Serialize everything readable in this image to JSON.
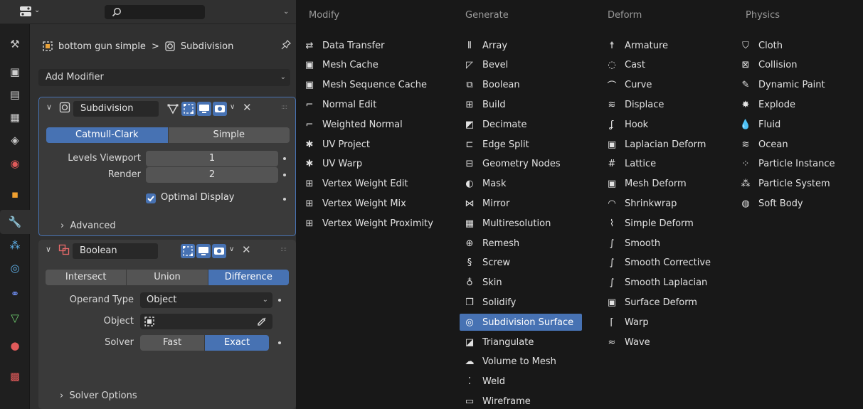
{
  "header": {
    "editor_icon": "properties-editor-icon",
    "search_icon": "search-icon"
  },
  "tabs": [
    {
      "name": "tool-tab",
      "icon": "tool-icon",
      "active": false
    },
    {
      "name": "render-tab",
      "icon": "camera-back-icon",
      "active": false
    },
    {
      "name": "output-tab",
      "icon": "printer-icon",
      "active": false
    },
    {
      "name": "view-layer-tab",
      "icon": "image-icon",
      "active": false
    },
    {
      "name": "scene-tab",
      "icon": "scene-icon",
      "active": false
    },
    {
      "name": "world-tab",
      "icon": "world-icon",
      "active": false
    },
    {
      "name": "object-tab",
      "icon": "object-icon",
      "active": false
    },
    {
      "name": "modifiers-tab",
      "icon": "wrench-icon",
      "active": true
    },
    {
      "name": "particles-tab",
      "icon": "particles-icon",
      "active": false
    },
    {
      "name": "physics-tab",
      "icon": "physics-icon",
      "active": false
    },
    {
      "name": "constraints-tab",
      "icon": "constraints-icon",
      "active": false
    },
    {
      "name": "data-tab",
      "icon": "mesh-data-icon",
      "active": false
    },
    {
      "name": "material-tab",
      "icon": "material-icon",
      "active": false
    },
    {
      "name": "texture-tab",
      "icon": "texture-icon",
      "active": false
    }
  ],
  "breadcrumb": {
    "object": "bottom gun simple",
    "separator": ">",
    "modifier": "Subdivision"
  },
  "add_modifier": {
    "label": "Add Modifier"
  },
  "subdivision": {
    "name": "Subdivision",
    "mode_options": [
      "Catmull-Clark",
      "Simple"
    ],
    "mode_selected": "Catmull-Clark",
    "levels_viewport_label": "Levels Viewport",
    "levels_viewport": "1",
    "render_label": "Render",
    "render": "2",
    "optimal_display_label": "Optimal Display",
    "optimal_display_checked": true,
    "advanced_label": "Advanced"
  },
  "boolean": {
    "name": "Boolean",
    "operation_options": [
      "Intersect",
      "Union",
      "Difference"
    ],
    "operation_selected": "Difference",
    "operand_type_label": "Operand Type",
    "operand_type": "Object",
    "object_label": "Object",
    "object_value": "",
    "solver_label": "Solver",
    "solver_options": [
      "Fast",
      "Exact"
    ],
    "solver_selected": "Exact",
    "solver_options_label": "Solver Options"
  },
  "menu": {
    "columns": [
      {
        "title": "Modify",
        "items": [
          {
            "label": "Data Transfer",
            "icon": "data-transfer-icon"
          },
          {
            "label": "Mesh Cache",
            "icon": "mesh-cache-icon"
          },
          {
            "label": "Mesh Sequence Cache",
            "icon": "mesh-sequence-cache-icon"
          },
          {
            "label": "Normal Edit",
            "icon": "normal-edit-icon"
          },
          {
            "label": "Weighted Normal",
            "icon": "weighted-normal-icon"
          },
          {
            "label": "UV Project",
            "icon": "uv-project-icon"
          },
          {
            "label": "UV Warp",
            "icon": "uv-warp-icon"
          },
          {
            "label": "Vertex Weight Edit",
            "icon": "vertex-weight-icon"
          },
          {
            "label": "Vertex Weight Mix",
            "icon": "vertex-weight-icon"
          },
          {
            "label": "Vertex Weight Proximity",
            "icon": "vertex-weight-icon"
          }
        ]
      },
      {
        "title": "Generate",
        "items": [
          {
            "label": "Array",
            "icon": "array-icon"
          },
          {
            "label": "Bevel",
            "icon": "bevel-icon"
          },
          {
            "label": "Boolean",
            "icon": "boolean-icon"
          },
          {
            "label": "Build",
            "icon": "build-icon"
          },
          {
            "label": "Decimate",
            "icon": "decimate-icon"
          },
          {
            "label": "Edge Split",
            "icon": "edge-split-icon"
          },
          {
            "label": "Geometry Nodes",
            "icon": "geometry-nodes-icon"
          },
          {
            "label": "Mask",
            "icon": "mask-icon"
          },
          {
            "label": "Mirror",
            "icon": "mirror-icon"
          },
          {
            "label": "Multiresolution",
            "icon": "multiresolution-icon"
          },
          {
            "label": "Remesh",
            "icon": "remesh-icon"
          },
          {
            "label": "Screw",
            "icon": "screw-icon"
          },
          {
            "label": "Skin",
            "icon": "skin-icon"
          },
          {
            "label": "Solidify",
            "icon": "solidify-icon"
          },
          {
            "label": "Subdivision Surface",
            "icon": "subdivision-surface-icon",
            "highlighted": true
          },
          {
            "label": "Triangulate",
            "icon": "triangulate-icon"
          },
          {
            "label": "Volume to Mesh",
            "icon": "volume-to-mesh-icon"
          },
          {
            "label": "Weld",
            "icon": "weld-icon"
          },
          {
            "label": "Wireframe",
            "icon": "wireframe-icon"
          }
        ]
      },
      {
        "title": "Deform",
        "items": [
          {
            "label": "Armature",
            "icon": "armature-icon"
          },
          {
            "label": "Cast",
            "icon": "cast-icon"
          },
          {
            "label": "Curve",
            "icon": "curve-icon"
          },
          {
            "label": "Displace",
            "icon": "displace-icon"
          },
          {
            "label": "Hook",
            "icon": "hook-icon"
          },
          {
            "label": "Laplacian Deform",
            "icon": "laplacian-deform-icon"
          },
          {
            "label": "Lattice",
            "icon": "lattice-icon"
          },
          {
            "label": "Mesh Deform",
            "icon": "mesh-deform-icon"
          },
          {
            "label": "Shrinkwrap",
            "icon": "shrinkwrap-icon"
          },
          {
            "label": "Simple Deform",
            "icon": "simple-deform-icon"
          },
          {
            "label": "Smooth",
            "icon": "smooth-icon"
          },
          {
            "label": "Smooth Corrective",
            "icon": "smooth-icon"
          },
          {
            "label": "Smooth Laplacian",
            "icon": "smooth-icon"
          },
          {
            "label": "Surface Deform",
            "icon": "surface-deform-icon"
          },
          {
            "label": "Warp",
            "icon": "warp-icon"
          },
          {
            "label": "Wave",
            "icon": "wave-icon"
          }
        ]
      },
      {
        "title": "Physics",
        "items": [
          {
            "label": "Cloth",
            "icon": "cloth-icon"
          },
          {
            "label": "Collision",
            "icon": "collision-icon"
          },
          {
            "label": "Dynamic Paint",
            "icon": "dynamic-paint-icon"
          },
          {
            "label": "Explode",
            "icon": "explode-icon"
          },
          {
            "label": "Fluid",
            "icon": "fluid-icon"
          },
          {
            "label": "Ocean",
            "icon": "ocean-icon"
          },
          {
            "label": "Particle Instance",
            "icon": "particle-instance-icon"
          },
          {
            "label": "Particle System",
            "icon": "particle-system-icon"
          },
          {
            "label": "Soft Body",
            "icon": "soft-body-icon"
          }
        ]
      }
    ]
  },
  "colors": {
    "accent": "#4772b3",
    "panel_bg": "#303030",
    "menu_bg": "#181818",
    "menu_title": "#9a9a9a"
  }
}
